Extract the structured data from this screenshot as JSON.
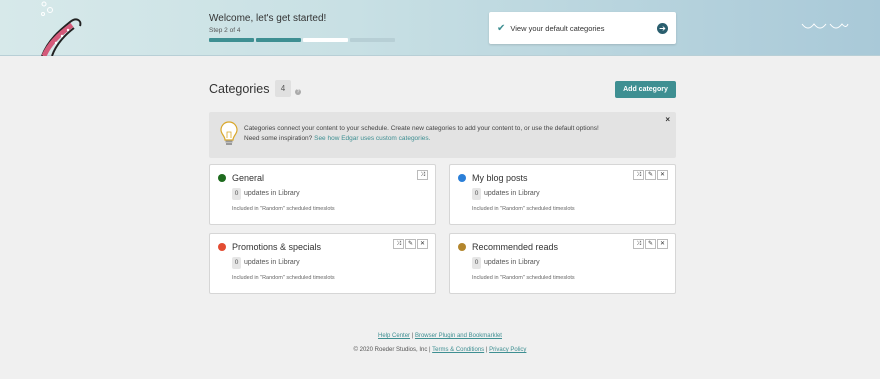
{
  "header": {
    "welcome": "Welcome, let's get started!",
    "step": "Step 2 of 4",
    "progress": {
      "total": 4,
      "done": 2,
      "current": 3
    },
    "cta_label": "View your default categories"
  },
  "page": {
    "title": "Categories",
    "count": "4",
    "help_glyph": "?",
    "add_button": "Add category"
  },
  "info": {
    "line1": "Categories connect your content to your schedule. Create new categories to add your content to, or use the default options!",
    "line2_prefix": "Need some inspiration?",
    "line2_link": "See how Edgar uses custom categories.",
    "close": "×"
  },
  "categories": [
    {
      "name": "General",
      "color": "#1e6b1e",
      "count": "0",
      "updates": "updates in Library",
      "included": "Included in \"Random\" scheduled timeslots",
      "editable": false
    },
    {
      "name": "My blog posts",
      "color": "#2b7fd8",
      "count": "0",
      "updates": "updates in Library",
      "included": "Included in \"Random\" scheduled timeslots",
      "editable": true
    },
    {
      "name": "Promotions & specials",
      "color": "#e34c32",
      "count": "0",
      "updates": "updates in Library",
      "included": "Included in \"Random\" scheduled timeslots",
      "editable": true
    },
    {
      "name": "Recommended reads",
      "color": "#b3862d",
      "count": "0",
      "updates": "updates in Library",
      "included": "Included in \"Random\" scheduled timeslots",
      "editable": true
    }
  ],
  "footer": {
    "help": "Help Center",
    "plugin": "Browser Plugin and Bookmarklet",
    "copyright": "© 2020 Roeder Studios, Inc",
    "terms": "Terms & Conditions",
    "privacy": "Privacy Policy"
  }
}
